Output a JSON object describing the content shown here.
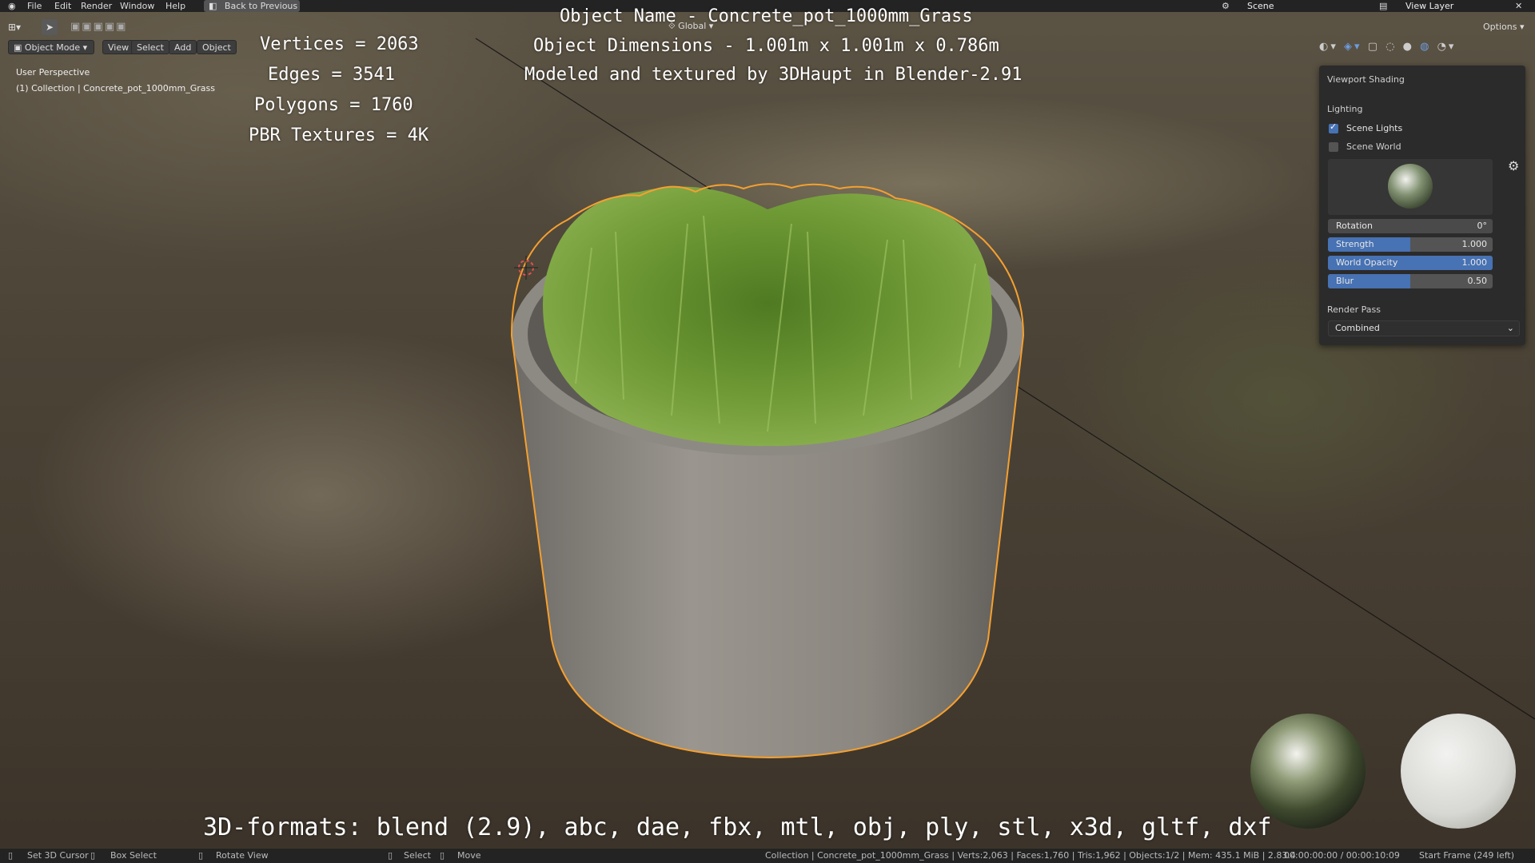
{
  "menu": {
    "items": [
      "File",
      "Edit",
      "Render",
      "Window",
      "Help"
    ],
    "back_button": "Back to Previous",
    "scene_label": "Scene",
    "view_layer_label": "View Layer"
  },
  "header": {
    "mode": "Object Mode",
    "view": "View",
    "select": "Select",
    "add": "Add",
    "object": "Object",
    "transform": "Global",
    "options": "Options"
  },
  "viewport": {
    "perspective": "User Perspective",
    "collection": "(1) Collection | Concrete_pot_1000mm_Grass"
  },
  "overlay": {
    "vertices": "Vertices = 2063",
    "edges": "Edges = 3541",
    "polygons": "Polygons = 1760",
    "textures": "PBR Textures = 4K",
    "object_name": "Object Name - Concrete_pot_1000mm_Grass",
    "dimensions": "Object Dimensions -  1.001m x 1.001m x 0.786m",
    "credit": "Modeled and textured by 3DHaupt in Blender-2.91",
    "formats": "3D-formats: blend (2.9), abc, dae, fbx, mtl, obj, ply, stl, x3d, gltf, dxf"
  },
  "shading_panel": {
    "title": "Viewport Shading",
    "lighting_label": "Lighting",
    "scene_lights": "Scene Lights",
    "scene_lights_checked": true,
    "scene_world": "Scene World",
    "scene_world_checked": false,
    "rotation_label": "Rotation",
    "rotation_value": "0°",
    "strength_label": "Strength",
    "strength_value": "1.000",
    "strength_fill": 0.5,
    "opacity_label": "World Opacity",
    "opacity_value": "1.000",
    "opacity_fill": 1.0,
    "blur_label": "Blur",
    "blur_value": "0.50",
    "blur_fill": 0.5,
    "render_pass_label": "Render Pass",
    "render_pass_value": "Combined"
  },
  "statusbar": {
    "set_cursor": "Set 3D Cursor",
    "box_select": "Box Select",
    "rotate_view": "Rotate View",
    "select": "Select",
    "move": "Move",
    "stats": "Collection | Concrete_pot_1000mm_Grass | Verts:2,063 | Faces:1,760 | Tris:1,962 | Objects:1/2 | Mem: 435.1 MiB | 2.83.4",
    "time": "00:00:00:00 / 00:00:10:09",
    "start_frame": "Start Frame (249 left)"
  },
  "colors": {
    "accent": "#4772b3",
    "selection_outline": "#f5a030",
    "grass": "#6f9a35",
    "pot": "#8a8781"
  }
}
